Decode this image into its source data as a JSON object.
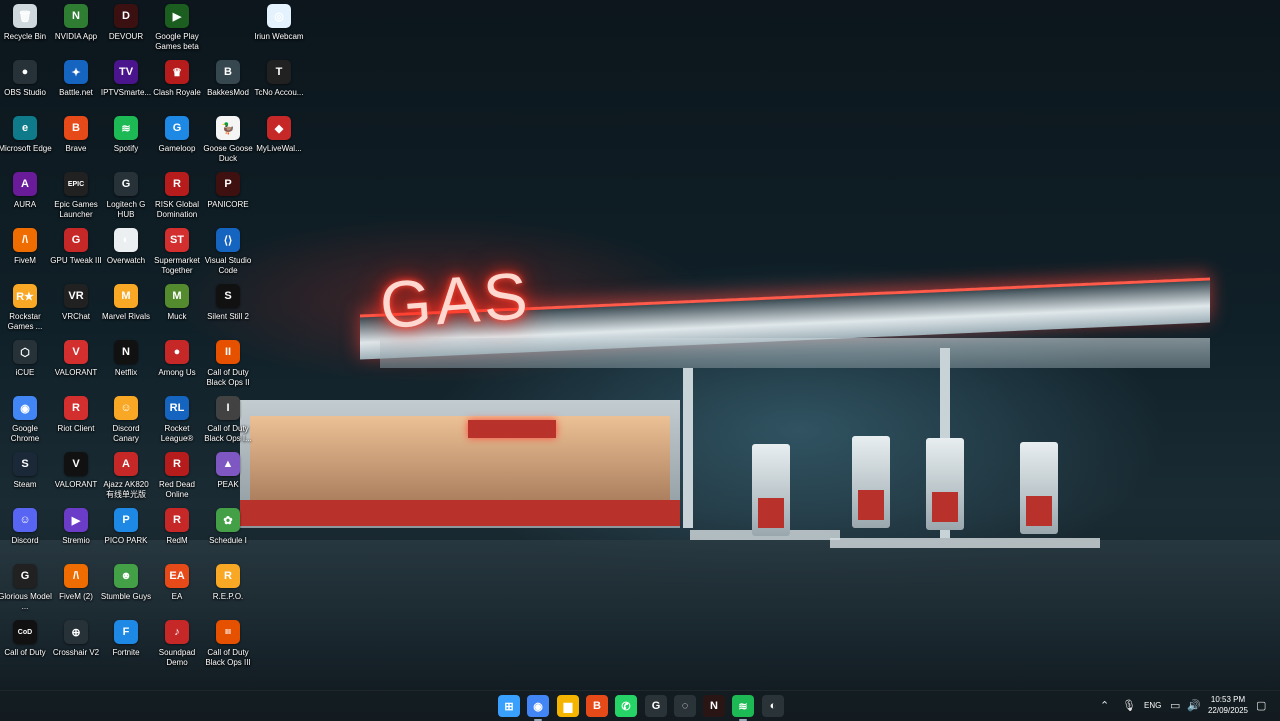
{
  "desktop": {
    "icons": [
      {
        "label": "Recycle Bin",
        "icon": "recycle-bin-icon",
        "color": "#cfd8dc",
        "glyph": "🗑",
        "col": 0,
        "row": 0
      },
      {
        "label": "NVIDIA App",
        "icon": "nvidia-icon",
        "color": "#2e7d32",
        "glyph": "N",
        "col": 1,
        "row": 0
      },
      {
        "label": "DEVOUR",
        "icon": "devour-icon",
        "color": "#3b1010",
        "glyph": "D",
        "col": 2,
        "row": 0
      },
      {
        "label": "Google Play Games beta",
        "icon": "google-play-games-icon",
        "color": "#1b5e20",
        "glyph": "▶",
        "col": 3,
        "row": 0
      },
      {
        "label": "Iriun Webcam",
        "icon": "iriun-webcam-icon",
        "color": "#e3f2fd",
        "glyph": "◎",
        "col": 5,
        "row": 0
      },
      {
        "label": "OBS Studio",
        "icon": "obs-studio-icon",
        "color": "#263238",
        "glyph": "●",
        "col": 0,
        "row": 1
      },
      {
        "label": "Battle.net",
        "icon": "battlenet-icon",
        "color": "#1565c0",
        "glyph": "✦",
        "col": 1,
        "row": 1
      },
      {
        "label": "IPTVSmarte...",
        "icon": "iptv-smarters-icon",
        "color": "#4a148c",
        "glyph": "TV",
        "col": 2,
        "row": 1
      },
      {
        "label": "Clash Royale",
        "icon": "clash-royale-icon",
        "color": "#b71c1c",
        "glyph": "♛",
        "col": 3,
        "row": 1
      },
      {
        "label": "BakkesMod",
        "icon": "bakkesmod-icon",
        "color": "#37474f",
        "glyph": "B",
        "col": 4,
        "row": 1
      },
      {
        "label": "TcNo Accou...",
        "icon": "tcno-account-icon",
        "color": "#212121",
        "glyph": "T",
        "col": 5,
        "row": 1
      },
      {
        "label": "Microsoft Edge",
        "icon": "edge-icon",
        "color": "#0f7b8a",
        "glyph": "e",
        "col": 0,
        "row": 2
      },
      {
        "label": "Brave",
        "icon": "brave-icon",
        "color": "#e64a19",
        "glyph": "B",
        "col": 1,
        "row": 2
      },
      {
        "label": "Spotify",
        "icon": "spotify-icon",
        "color": "#1db954",
        "glyph": "≋",
        "col": 2,
        "row": 2
      },
      {
        "label": "Gameloop",
        "icon": "gameloop-icon",
        "color": "#1e88e5",
        "glyph": "G",
        "col": 3,
        "row": 2
      },
      {
        "label": "Goose Goose Duck",
        "icon": "goose-goose-duck-icon",
        "color": "#f5f5f5",
        "glyph": "🦆",
        "col": 4,
        "row": 2
      },
      {
        "label": "MyLiveWal...",
        "icon": "mylivewallpaper-icon",
        "color": "#c62828",
        "glyph": "◆",
        "col": 5,
        "row": 2
      },
      {
        "label": "AURA",
        "icon": "aura-icon",
        "color": "#6a1b9a",
        "glyph": "A",
        "col": 0,
        "row": 3
      },
      {
        "label": "Epic Games Launcher",
        "icon": "epic-games-icon",
        "color": "#212121",
        "glyph": "EPIC",
        "col": 1,
        "row": 3
      },
      {
        "label": "Logitech G HUB",
        "icon": "logitech-ghub-icon",
        "color": "#263238",
        "glyph": "G",
        "col": 2,
        "row": 3
      },
      {
        "label": "RISK Global Domination",
        "icon": "risk-icon",
        "color": "#b71c1c",
        "glyph": "R",
        "col": 3,
        "row": 3
      },
      {
        "label": "PANICORE",
        "icon": "panicore-icon",
        "color": "#3e1010",
        "glyph": "P",
        "col": 4,
        "row": 3
      },
      {
        "label": "FiveM",
        "icon": "fivem-icon",
        "color": "#ef6c00",
        "glyph": "/\\",
        "col": 0,
        "row": 4
      },
      {
        "label": "GPU Tweak III",
        "icon": "gpu-tweak-icon",
        "color": "#c62828",
        "glyph": "G",
        "col": 1,
        "row": 4
      },
      {
        "label": "Overwatch",
        "icon": "overwatch-icon",
        "color": "#eceff1",
        "glyph": "◐",
        "col": 2,
        "row": 4
      },
      {
        "label": "Supermarket Together",
        "icon": "supermarket-together-icon",
        "color": "#d32f2f",
        "glyph": "ST",
        "col": 3,
        "row": 4
      },
      {
        "label": "Visual Studio Code",
        "icon": "vscode-icon",
        "color": "#1565c0",
        "glyph": "⟨⟩",
        "col": 4,
        "row": 4
      },
      {
        "label": "Rockstar Games ...",
        "icon": "rockstar-icon",
        "color": "#f9a825",
        "glyph": "R★",
        "col": 0,
        "row": 5
      },
      {
        "label": "VRChat",
        "icon": "vrchat-icon",
        "color": "#212121",
        "glyph": "VR",
        "col": 1,
        "row": 5
      },
      {
        "label": "Marvel Rivals",
        "icon": "marvel-rivals-icon",
        "color": "#f9a825",
        "glyph": "M",
        "col": 2,
        "row": 5
      },
      {
        "label": "Muck",
        "icon": "muck-icon",
        "color": "#558b2f",
        "glyph": "M",
        "col": 3,
        "row": 5
      },
      {
        "label": "Silent Still 2",
        "icon": "silent-still-icon",
        "color": "#111111",
        "glyph": "S",
        "col": 4,
        "row": 5
      },
      {
        "label": "iCUE",
        "icon": "icue-icon",
        "color": "#263238",
        "glyph": "⬡",
        "col": 0,
        "row": 6
      },
      {
        "label": "VALORANT",
        "icon": "valorant-icon",
        "color": "#d32f2f",
        "glyph": "V",
        "col": 1,
        "row": 6
      },
      {
        "label": "Netflix",
        "icon": "netflix-icon",
        "color": "#111111",
        "glyph": "N",
        "col": 2,
        "row": 6
      },
      {
        "label": "Among Us",
        "icon": "among-us-icon",
        "color": "#c62828",
        "glyph": "●",
        "col": 3,
        "row": 6
      },
      {
        "label": "Call of Duty Black Ops II",
        "icon": "cod-bo2-icon",
        "color": "#e65100",
        "glyph": "II",
        "col": 4,
        "row": 6
      },
      {
        "label": "Google Chrome",
        "icon": "chrome-icon",
        "color": "#4285f4",
        "glyph": "◉",
        "col": 0,
        "row": 7
      },
      {
        "label": "Riot Client",
        "icon": "riot-client-icon",
        "color": "#d32f2f",
        "glyph": "R",
        "col": 1,
        "row": 7
      },
      {
        "label": "Discord Canary",
        "icon": "discord-canary-icon",
        "color": "#f9a825",
        "glyph": "☺",
        "col": 2,
        "row": 7
      },
      {
        "label": "Rocket League®",
        "icon": "rocket-league-icon",
        "color": "#1565c0",
        "glyph": "RL",
        "col": 3,
        "row": 7
      },
      {
        "label": "Call of Duty Black Ops I...",
        "icon": "cod-bo-icon",
        "color": "#424242",
        "glyph": "I",
        "col": 4,
        "row": 7
      },
      {
        "label": "Steam",
        "icon": "steam-icon",
        "color": "#1b2838",
        "glyph": "S",
        "col": 0,
        "row": 8
      },
      {
        "label": "VALORANT",
        "icon": "valorant-icon",
        "color": "#111111",
        "glyph": "V",
        "col": 1,
        "row": 8
      },
      {
        "label": "Ajazz AK820 有线单光版",
        "icon": "ajazz-icon",
        "color": "#c62828",
        "glyph": "A",
        "col": 2,
        "row": 8
      },
      {
        "label": "Red Dead Online",
        "icon": "red-dead-online-icon",
        "color": "#b71c1c",
        "glyph": "R",
        "col": 3,
        "row": 8
      },
      {
        "label": "PEAK",
        "icon": "peak-icon",
        "color": "#7e57c2",
        "glyph": "▲",
        "col": 4,
        "row": 8
      },
      {
        "label": "Discord",
        "icon": "discord-icon",
        "color": "#5865f2",
        "glyph": "☺",
        "col": 0,
        "row": 9
      },
      {
        "label": "Stremio",
        "icon": "stremio-icon",
        "color": "#6a3cc8",
        "glyph": "▶",
        "col": 1,
        "row": 9
      },
      {
        "label": "PICO PARK",
        "icon": "pico-park-icon",
        "color": "#1e88e5",
        "glyph": "P",
        "col": 2,
        "row": 9
      },
      {
        "label": "RedM",
        "icon": "redm-icon",
        "color": "#c62828",
        "glyph": "R",
        "col": 3,
        "row": 9
      },
      {
        "label": "Schedule I",
        "icon": "schedule-i-icon",
        "color": "#43a047",
        "glyph": "✿",
        "col": 4,
        "row": 9
      },
      {
        "label": "Glorious Model ...",
        "icon": "glorious-icon",
        "color": "#212121",
        "glyph": "G",
        "col": 0,
        "row": 10
      },
      {
        "label": "FiveM (2)",
        "icon": "fivem-icon",
        "color": "#ef6c00",
        "glyph": "/\\",
        "col": 1,
        "row": 10
      },
      {
        "label": "Stumble Guys",
        "icon": "stumble-guys-icon",
        "color": "#43a047",
        "glyph": "☻",
        "col": 2,
        "row": 10
      },
      {
        "label": "EA",
        "icon": "ea-icon",
        "color": "#e64a19",
        "glyph": "EA",
        "col": 3,
        "row": 10
      },
      {
        "label": "R.E.P.O.",
        "icon": "repo-icon",
        "color": "#f9a825",
        "glyph": "R",
        "col": 4,
        "row": 10
      },
      {
        "label": "Call of Duty",
        "icon": "call-of-duty-icon",
        "color": "#111111",
        "glyph": "CoD",
        "col": 0,
        "row": 11
      },
      {
        "label": "Crosshair V2",
        "icon": "crosshair-icon",
        "color": "#263238",
        "glyph": "⊕",
        "col": 1,
        "row": 11
      },
      {
        "label": "Fortnite",
        "icon": "fortnite-icon",
        "color": "#1e88e5",
        "glyph": "F",
        "col": 2,
        "row": 11
      },
      {
        "label": "Soundpad Demo",
        "icon": "soundpad-icon",
        "color": "#c62828",
        "glyph": "♪",
        "col": 3,
        "row": 11
      },
      {
        "label": "Call of Duty Black Ops III",
        "icon": "cod-bo3-icon",
        "color": "#e65100",
        "glyph": "III",
        "col": 4,
        "row": 11
      }
    ]
  },
  "wallpaper": {
    "sign_text": "GAS"
  },
  "taskbar": {
    "apps": [
      {
        "name": "start-button",
        "icon": "windows-icon",
        "glyph": "⊞",
        "color": "#3aa0ff",
        "active": false
      },
      {
        "name": "taskbar-chrome",
        "icon": "chrome-icon",
        "glyph": "◉",
        "color": "#4285f4",
        "active": true
      },
      {
        "name": "taskbar-file-explorer",
        "icon": "folder-icon",
        "glyph": "▆",
        "color": "#f4b400",
        "active": false
      },
      {
        "name": "taskbar-brave",
        "icon": "brave-icon",
        "glyph": "B",
        "color": "#e64a19",
        "active": false
      },
      {
        "name": "taskbar-whatsapp",
        "icon": "whatsapp-icon",
        "glyph": "✆",
        "color": "#25d366",
        "active": false
      },
      {
        "name": "taskbar-logitech",
        "icon": "logitech-ghub-icon",
        "glyph": "G",
        "color": "#2a3338",
        "active": false
      },
      {
        "name": "taskbar-crosshair",
        "icon": "crosshair-icon",
        "glyph": "◌",
        "color": "#2a3338",
        "active": false
      },
      {
        "name": "taskbar-netflix",
        "icon": "netflix-icon",
        "glyph": "N",
        "color": "#2a1515",
        "active": false
      },
      {
        "name": "taskbar-spotify",
        "icon": "spotify-icon",
        "glyph": "≋",
        "color": "#1db954",
        "active": true
      },
      {
        "name": "taskbar-overwatch",
        "icon": "overwatch-icon",
        "glyph": "◐",
        "color": "#2a3338",
        "active": false
      }
    ],
    "tray": {
      "language": "ENG",
      "time": "10:53 PM",
      "date": "22/09/2025"
    }
  }
}
